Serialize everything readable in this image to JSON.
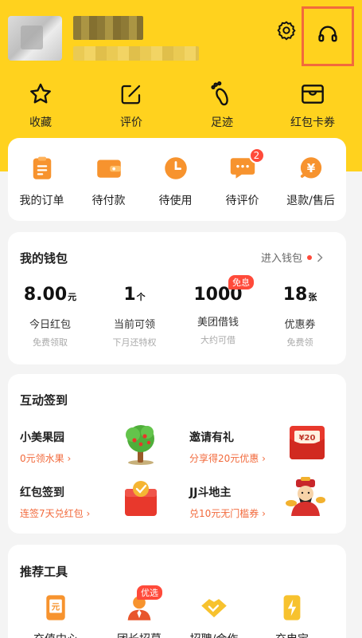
{
  "header": {
    "settings_icon": "gear-icon",
    "service_icon": "headset-icon",
    "highlight_color": "#f26a3c",
    "quick_links": [
      {
        "label": "收藏",
        "icon": "star-icon"
      },
      {
        "label": "评价",
        "icon": "edit-icon"
      },
      {
        "label": "足迹",
        "icon": "footprint-icon"
      },
      {
        "label": "红包卡券",
        "icon": "wallet-card-icon"
      }
    ]
  },
  "orders": [
    {
      "label": "我的订单",
      "icon": "order-list-icon"
    },
    {
      "label": "待付款",
      "icon": "pending-payment-icon"
    },
    {
      "label": "待使用",
      "icon": "clock-icon"
    },
    {
      "label": "待评价",
      "icon": "comment-icon",
      "badge": "2"
    },
    {
      "label": "退款/售后",
      "icon": "refund-icon"
    }
  ],
  "wallet": {
    "title": "我的钱包",
    "link_label": "进入钱包",
    "free_tag": "免息",
    "stats": [
      {
        "value": "8.00",
        "unit": "元",
        "label": "今日红包",
        "sub": "免费领取"
      },
      {
        "value": "1",
        "unit": "个",
        "label": "当前可领",
        "sub": "下月还特权"
      },
      {
        "value": "1000",
        "unit": "",
        "label": "美团借钱",
        "sub": "大约可借"
      },
      {
        "value": "18",
        "unit": "张",
        "label": "优惠券",
        "sub": "免费领"
      }
    ]
  },
  "checkin": {
    "title": "互动签到",
    "items": [
      {
        "title": "小美果园",
        "sub": "0元领水果 ›",
        "icon": "fruit-tree-icon"
      },
      {
        "title": "邀请有礼",
        "sub": "分享得20元优惠 ›",
        "icon": "red-envelope-icon",
        "envelope_amount": "¥20"
      },
      {
        "title": "红包签到",
        "sub": "连签7天兑红包 ›",
        "icon": "gift-box-icon"
      },
      {
        "title": "JJ斗地主",
        "sub": "兑10元无门槛券 ›",
        "icon": "god-of-wealth-icon"
      }
    ]
  },
  "tools": {
    "title": "推荐工具",
    "promo_tag": "优选",
    "items": [
      {
        "label": "充值中心",
        "icon": "phone-recharge-icon"
      },
      {
        "label": "团长招募",
        "icon": "team-leader-icon"
      },
      {
        "label": "招聘/合作",
        "icon": "handshake-icon"
      },
      {
        "label": "充电宝",
        "icon": "power-bank-icon"
      }
    ]
  }
}
